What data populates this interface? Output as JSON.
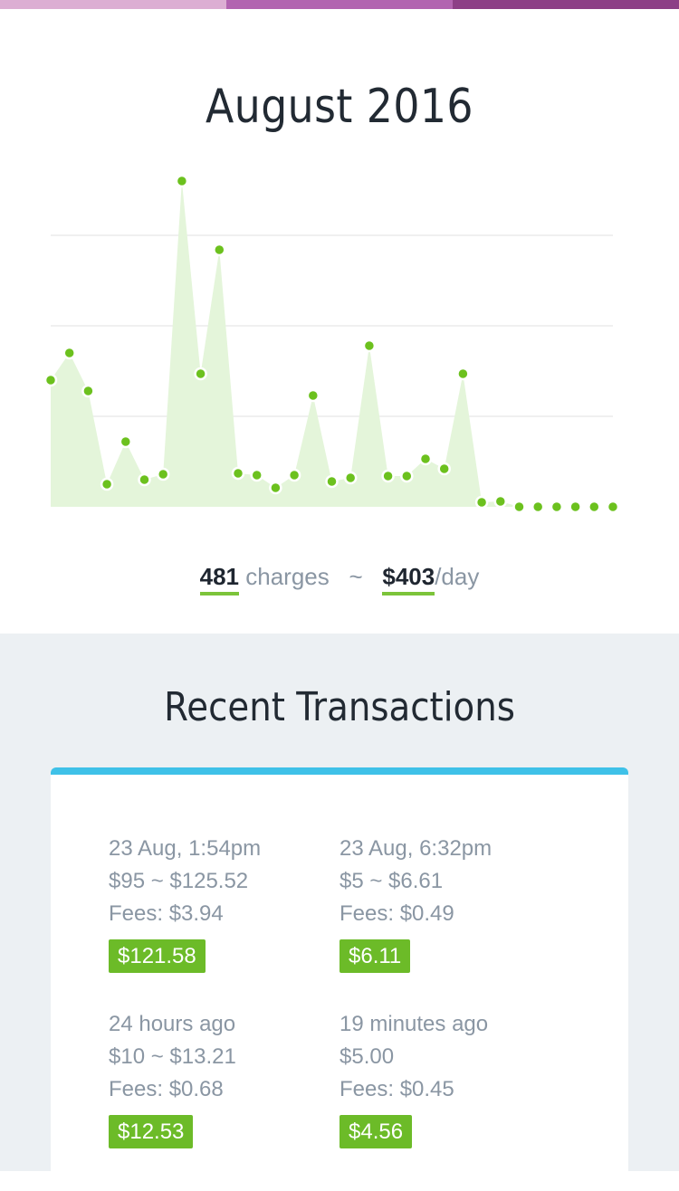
{
  "colors": {
    "topbar": [
      "#dcaed3",
      "#b264b0",
      "#8d3f86"
    ],
    "accent_green": "#6cbb28",
    "point_green": "#6cc11e",
    "area_fill": "#e4f5da",
    "card_top": "#3fc1e8"
  },
  "header": {
    "title": "August 2016"
  },
  "stats": {
    "charges_count": "481",
    "charges_label": "charges",
    "separator": "~",
    "per_day_value": "$403",
    "per_day_suffix": "/day"
  },
  "chart_data": {
    "type": "area",
    "x": [
      1,
      2,
      3,
      4,
      5,
      6,
      7,
      8,
      9,
      10,
      11,
      12,
      13,
      14,
      15,
      16,
      17,
      18,
      19,
      20,
      21,
      22,
      23,
      24,
      25,
      26,
      27,
      28,
      29,
      30,
      31
    ],
    "y": [
      140,
      170,
      128,
      25,
      72,
      30,
      36,
      360,
      147,
      284,
      37,
      35,
      21,
      35,
      123,
      28,
      32,
      178,
      34,
      34,
      53,
      42,
      147,
      5,
      6,
      0,
      0,
      0,
      0,
      0,
      0
    ],
    "ylim": [
      0,
      360
    ],
    "grid": true,
    "gridlines_y": [
      100,
      200,
      300
    ]
  },
  "transactions": {
    "title": "Recent Transactions",
    "items": [
      {
        "time": "23 Aug, 1:54pm",
        "amount_line": "$95 ~ $125.52",
        "fees": "Fees: $3.94",
        "net": "$121.58"
      },
      {
        "time": "23 Aug, 6:32pm",
        "amount_line": "$5 ~ $6.61",
        "fees": "Fees: $0.49",
        "net": "$6.11"
      },
      {
        "time": "24 hours ago",
        "amount_line": "$10 ~ $13.21",
        "fees": "Fees: $0.68",
        "net": "$12.53"
      },
      {
        "time": "19 minutes ago",
        "amount_line": "$5.00",
        "fees": "Fees: $0.45",
        "net": "$4.56"
      }
    ]
  }
}
